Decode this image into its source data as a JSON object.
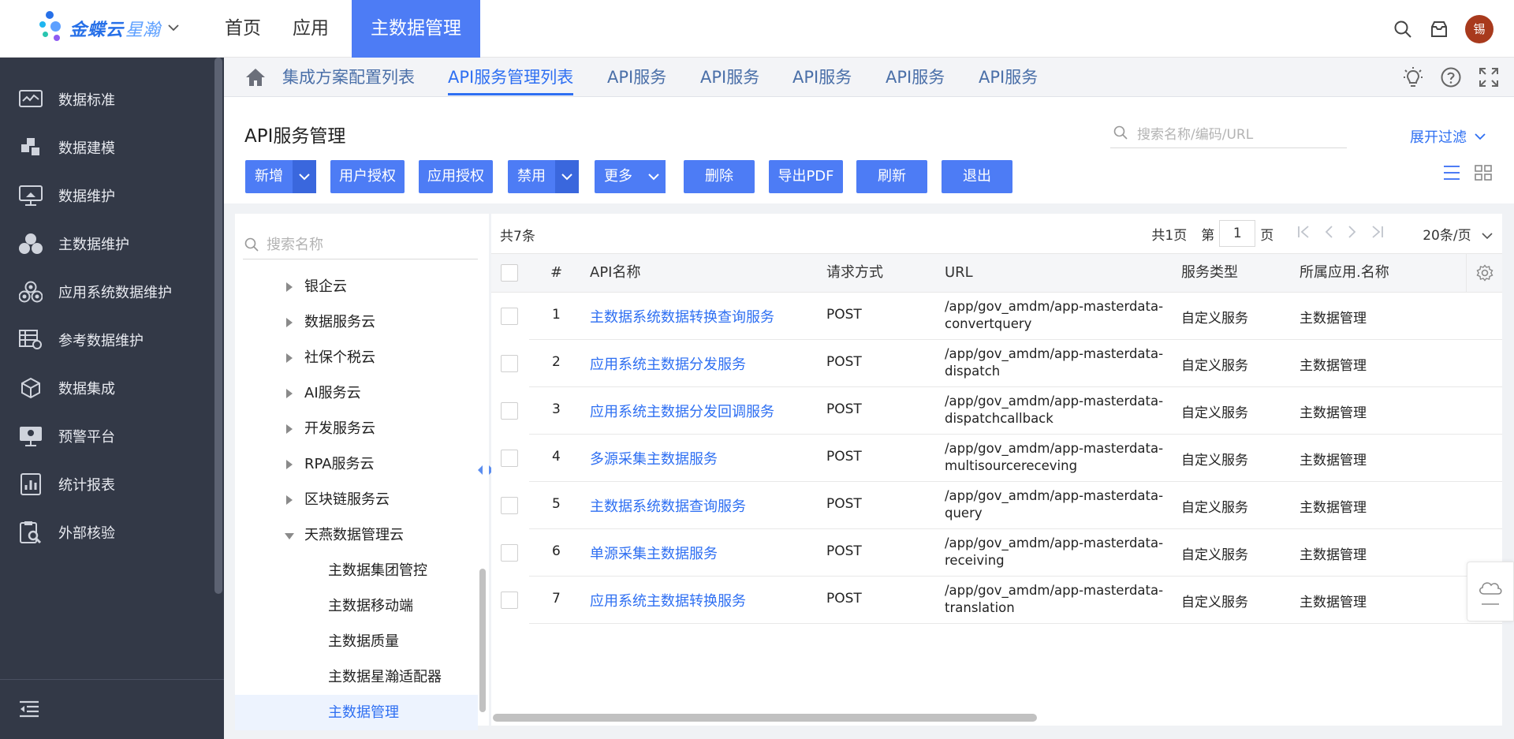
{
  "brand": {
    "name_main": "金蝶云",
    "name_sub": "星瀚"
  },
  "top_nav": [
    "首页",
    "应用",
    "主数据管理"
  ],
  "user": {
    "avatar_text": "锡"
  },
  "sidebar": {
    "items": [
      {
        "label": "数据标准",
        "icon": "chart-monitor-icon"
      },
      {
        "label": "数据建模",
        "icon": "puzzle-icon"
      },
      {
        "label": "数据维护",
        "icon": "screen-icon"
      },
      {
        "label": "主数据维护",
        "icon": "group-icon"
      },
      {
        "label": "应用系统数据维护",
        "icon": "cluster-icon"
      },
      {
        "label": "参考数据维护",
        "icon": "table-gear-icon"
      },
      {
        "label": "数据集成",
        "icon": "cube-icon"
      },
      {
        "label": "预警平台",
        "icon": "alert-screen-icon"
      },
      {
        "label": "统计报表",
        "icon": "report-icon"
      },
      {
        "label": "外部核验",
        "icon": "clipboard-search-icon"
      }
    ]
  },
  "tabs": [
    "集成方案配置列表",
    "API服务管理列表",
    "API服务",
    "API服务",
    "API服务",
    "API服务",
    "API服务"
  ],
  "active_tab": 1,
  "page": {
    "title": "API服务管理",
    "search_placeholder": "搜索名称/编码/URL",
    "expand_filter": "展开过滤"
  },
  "toolbar": {
    "add": "新增",
    "user_auth": "用户授权",
    "app_auth": "应用授权",
    "disable": "禁用",
    "more": "更多",
    "delete": "删除",
    "export_pdf": "导出PDF",
    "refresh": "刷新",
    "exit": "退出"
  },
  "tree": {
    "search_placeholder": "搜索名称",
    "nodes": [
      {
        "label": "银企云",
        "state": "collapsed",
        "level": 1
      },
      {
        "label": "数据服务云",
        "state": "collapsed",
        "level": 1
      },
      {
        "label": "社保个税云",
        "state": "collapsed",
        "level": 1
      },
      {
        "label": "AI服务云",
        "state": "collapsed",
        "level": 1
      },
      {
        "label": "开发服务云",
        "state": "collapsed",
        "level": 1
      },
      {
        "label": "RPA服务云",
        "state": "collapsed",
        "level": 1
      },
      {
        "label": "区块链服务云",
        "state": "collapsed",
        "level": 1
      },
      {
        "label": "天燕数据管理云",
        "state": "expanded",
        "level": 1
      },
      {
        "label": "主数据集团管控",
        "state": "leaf",
        "level": 2
      },
      {
        "label": "主数据移动端",
        "state": "leaf",
        "level": 2
      },
      {
        "label": "主数据质量",
        "state": "leaf",
        "level": 2
      },
      {
        "label": "主数据星瀚适配器",
        "state": "leaf",
        "level": 2
      },
      {
        "label": "主数据管理",
        "state": "selected",
        "level": 2
      }
    ]
  },
  "grid": {
    "total": "共7条",
    "pager": {
      "pages": "共1页",
      "page_prefix": "第",
      "page_value": "1",
      "page_suffix": "页",
      "page_size": "20条/页"
    },
    "columns": [
      "#",
      "API名称",
      "请求方式",
      "URL",
      "服务类型",
      "所属应用.名称"
    ],
    "rows": [
      {
        "no": "1",
        "name": "主数据系统数据转换查询服务",
        "method": "POST",
        "url1": "/app/gov_amdm/app-masterdata-",
        "url2": "convertquery",
        "type": "自定义服务",
        "app": "主数据管理"
      },
      {
        "no": "2",
        "name": "应用系统主数据分发服务",
        "method": "POST",
        "url1": "/app/gov_amdm/app-masterdata-",
        "url2": "dispatch",
        "type": "自定义服务",
        "app": "主数据管理"
      },
      {
        "no": "3",
        "name": "应用系统主数据分发回调服务",
        "method": "POST",
        "url1": "/app/gov_amdm/app-masterdata-",
        "url2": "dispatchcallback",
        "type": "自定义服务",
        "app": "主数据管理"
      },
      {
        "no": "4",
        "name": "多源采集主数据服务",
        "method": "POST",
        "url1": "/app/gov_amdm/app-masterdata-",
        "url2": "multisourcereceving",
        "type": "自定义服务",
        "app": "主数据管理"
      },
      {
        "no": "5",
        "name": "主数据系统数据查询服务",
        "method": "POST",
        "url1": "/app/gov_amdm/app-masterdata-",
        "url2": "query",
        "type": "自定义服务",
        "app": "主数据管理"
      },
      {
        "no": "6",
        "name": "单源采集主数据服务",
        "method": "POST",
        "url1": "/app/gov_amdm/app-masterdata-",
        "url2": "receiving",
        "type": "自定义服务",
        "app": "主数据管理"
      },
      {
        "no": "7",
        "name": "应用系统主数据转换服务",
        "method": "POST",
        "url1": "/app/gov_amdm/app-masterdata-",
        "url2": "translation",
        "type": "自定义服务",
        "app": "主数据管理"
      }
    ]
  },
  "colors": {
    "primary": "#4d7cf5",
    "link": "#2e6ff2",
    "sidebar_bg": "#333947",
    "avatar_bg": "#a83a1d"
  }
}
